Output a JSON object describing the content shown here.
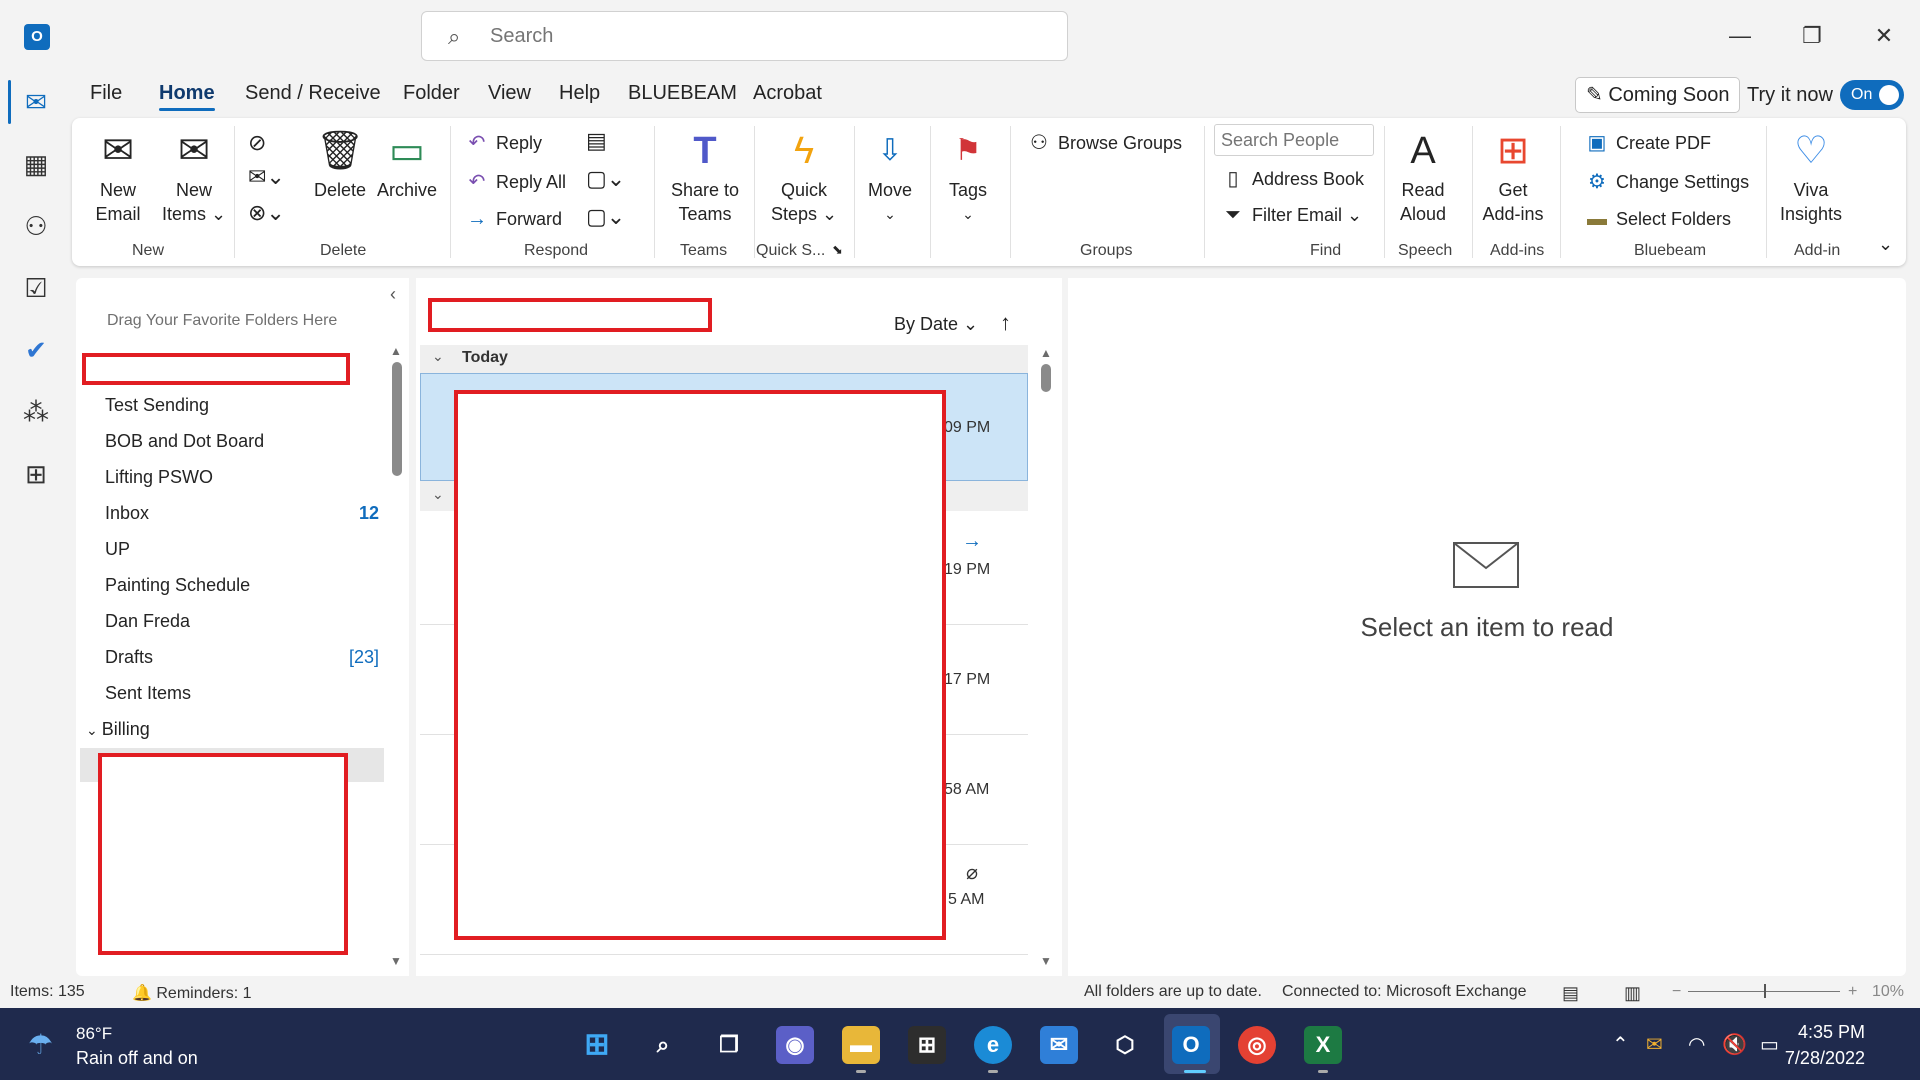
{
  "titlebar": {
    "app_icon_label": "O",
    "search_placeholder": "Search",
    "minimize": "—",
    "restore": "❐",
    "close": "✕"
  },
  "menu": {
    "tabs": [
      "File",
      "Home",
      "Send / Receive",
      "Folder",
      "View",
      "Help",
      "BLUEBEAM",
      "Acrobat"
    ],
    "active": "Home",
    "coming_soon": "Coming Soon",
    "try_it_now": "Try it now",
    "toggle": "On"
  },
  "ribbon": {
    "new_email": "New\nEmail",
    "new_items": "New\nItems ⌄",
    "delete": "Delete",
    "archive": "Archive",
    "reply": "Reply",
    "reply_all": "Reply All",
    "forward": "Forward",
    "share_to_teams": "Share to\nTeams",
    "quick_steps": "Quick\nSteps ⌄",
    "move": "Move",
    "tags": "Tags",
    "browse_groups": "Browse Groups",
    "search_people_placeholder": "Search People",
    "address_book": "Address Book",
    "filter_email": "Filter Email ⌄",
    "read_aloud": "Read\nAloud",
    "get_addins": "Get\nAdd-ins",
    "create_pdf": "Create PDF",
    "change_settings": "Change Settings",
    "select_folders": "Select Folders",
    "viva_insights": "Viva\nInsights",
    "groups": {
      "new": "New",
      "delete": "Delete",
      "respond": "Respond",
      "teams": "Teams",
      "quick_steps": "Quick S...",
      "groups": "Groups",
      "find": "Find",
      "speech": "Speech",
      "addins": "Add-ins",
      "bluebeam": "Bluebeam",
      "addin": "Add-in"
    }
  },
  "folders": {
    "favorites_hint": "Drag Your Favorite Folders Here",
    "items": [
      {
        "name": "Test Sending",
        "count": ""
      },
      {
        "name": "BOB and Dot Board",
        "count": ""
      },
      {
        "name": "Lifting PSWO",
        "count": ""
      },
      {
        "name": "Inbox",
        "count": "12"
      },
      {
        "name": "UP",
        "count": ""
      },
      {
        "name": "Painting Schedule",
        "count": ""
      },
      {
        "name": "Dan Freda",
        "count": ""
      },
      {
        "name": "Drafts",
        "count": "[23]"
      },
      {
        "name": "Sent Items",
        "count": ""
      },
      {
        "name": "Billing",
        "count": ""
      }
    ]
  },
  "messages": {
    "sort_by": "By Date ⌄",
    "sort_dir": "↑",
    "group_today": "Today",
    "times": [
      "09 PM",
      "19 PM",
      "17 PM",
      "58 AM",
      "5 AM"
    ]
  },
  "reading_pane": {
    "empty_text": "Select an item to read"
  },
  "status": {
    "items": "Items: 135",
    "reminders": "Reminders: 1",
    "sync": "All folders are up to date.",
    "connection": "Connected to: Microsoft Exchange",
    "zoom": "10%"
  },
  "taskbar": {
    "temperature": "86°F",
    "weather": "Rain off and on",
    "time": "4:35 PM",
    "date": "7/28/2022",
    "excel_label": "X",
    "outlook_label": "O"
  },
  "colors": {
    "accent": "#0f6cbd",
    "redaction": "#e11d22",
    "selected_row": "#cce4f7",
    "taskbar": "#1f2a4d"
  }
}
